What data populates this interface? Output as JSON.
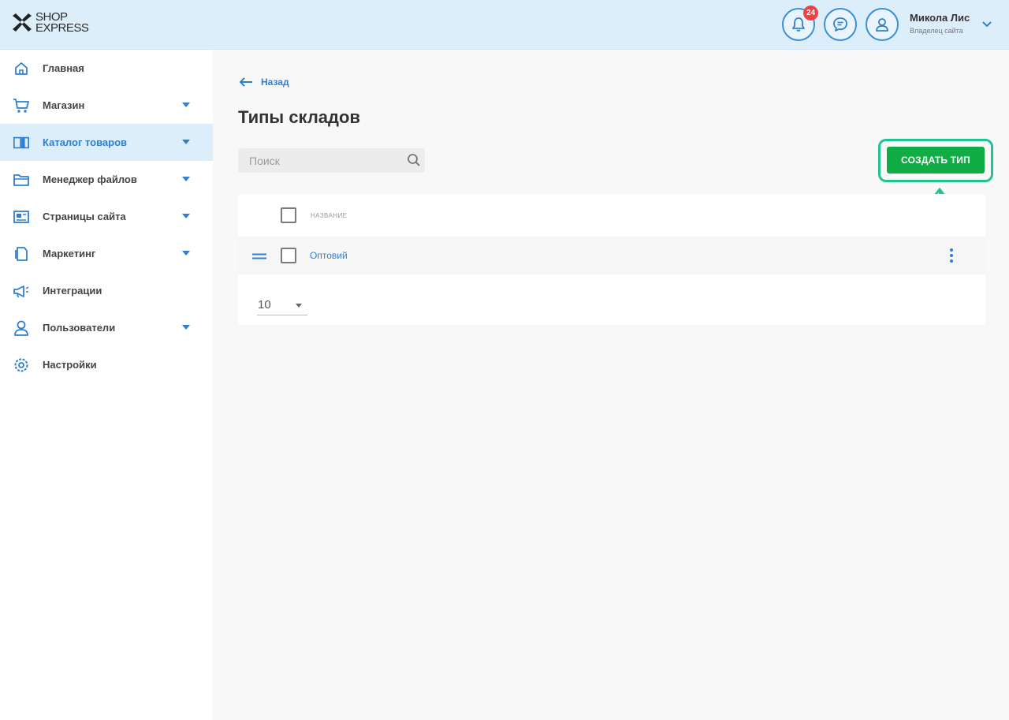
{
  "app": {
    "logo_line1": "SHOP",
    "logo_line2": "EXPRESS"
  },
  "header": {
    "notifications_count": "24",
    "user_name": "Микола Лис",
    "user_role": "Владелец сайта",
    "accent": "#2f7fd1"
  },
  "sidebar": {
    "items": [
      {
        "label": "Главная",
        "icon": "home-icon"
      },
      {
        "label": "Магазин",
        "icon": "cart-icon"
      },
      {
        "label": "Каталог товаров",
        "icon": "book-icon"
      },
      {
        "label": "Менеджер файлов",
        "icon": "folder-icon"
      },
      {
        "label": "Страницы сайта",
        "icon": "page-icon"
      },
      {
        "label": "Маркетинг",
        "icon": "marketing-icon"
      },
      {
        "label": "Интеграции",
        "icon": "megaphone-icon"
      },
      {
        "label": "Пользователи",
        "icon": "users-icon"
      },
      {
        "label": "Настройки",
        "icon": "gear-icon"
      }
    ]
  },
  "main": {
    "back_label": "Назад",
    "title": "Типы складов",
    "search_placeholder": "Поиск",
    "create_button": "СОЗДАТЬ ТИП",
    "highlight_color": "#1fc493",
    "table": {
      "column_header": "название",
      "rows": [
        {
          "name": "Оптовий"
        }
      ]
    },
    "per_page": "10"
  }
}
